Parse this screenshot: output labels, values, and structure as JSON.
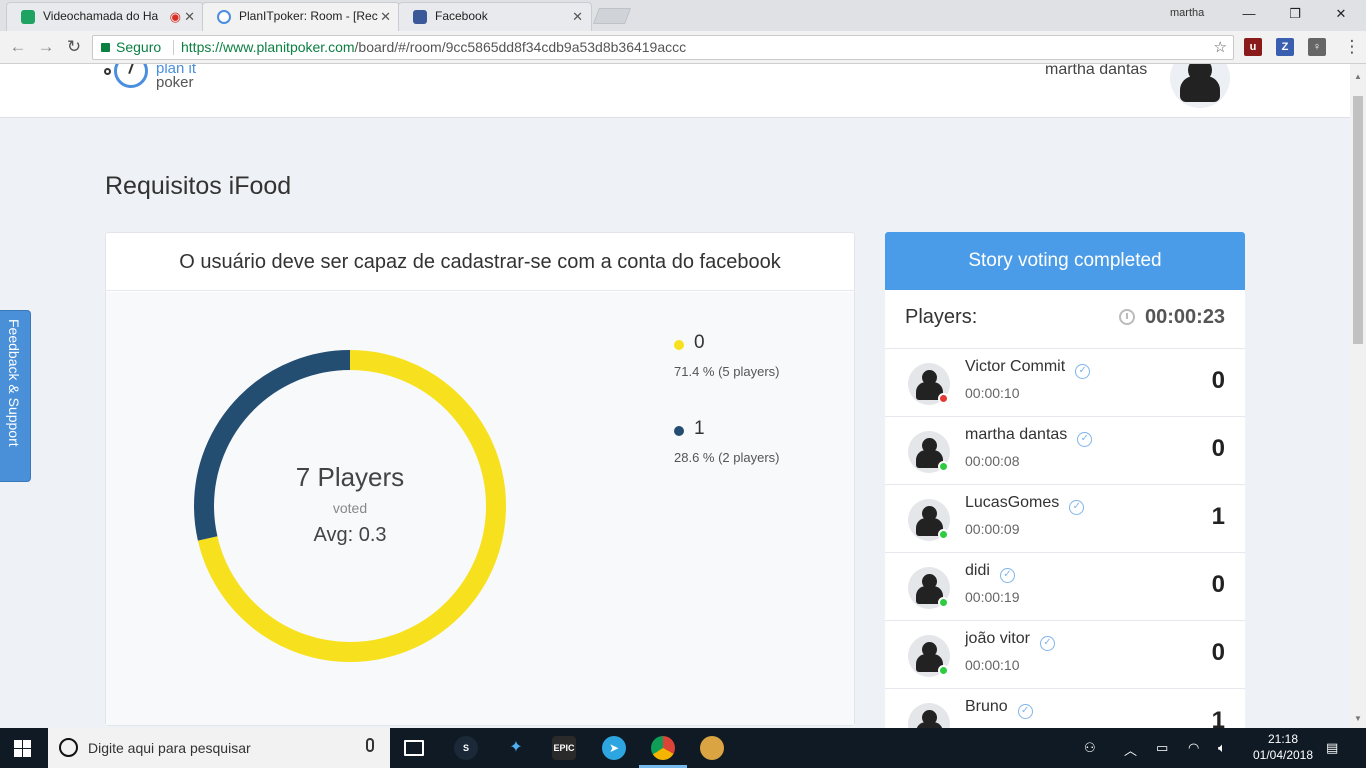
{
  "browser": {
    "tabs": [
      {
        "title": "Videochamada do Ha",
        "icon_color": "#1ea362"
      },
      {
        "title": "PlanITpoker: Room - [Rec",
        "icon_color": "#4a8fdf"
      },
      {
        "title": "Facebook",
        "icon_color": "#3b5998"
      }
    ],
    "profile_name": "martha",
    "secure_label": "Seguro",
    "url_host": "https://www.planitpoker.com",
    "url_path": "/board/#/room/9cc5865dd8f34cdb9a53d8b36419accc"
  },
  "header": {
    "brand_top": "plan it",
    "brand_bottom": "poker",
    "username": "martha dantas"
  },
  "room": {
    "title": "Requisitos iFood"
  },
  "story": {
    "title": "O usuário deve ser capaz de cadastrar-se com a conta do facebook",
    "center_players": "7 Players",
    "center_voted": "voted",
    "center_avg": "Avg: 0.3"
  },
  "chart_data": {
    "type": "pie",
    "donut": true,
    "categories": [
      "0",
      "1"
    ],
    "values": [
      71.4,
      28.6
    ],
    "players": [
      5,
      2
    ],
    "colors": [
      "#f7e11e",
      "#234d71"
    ],
    "legend": [
      {
        "label": "0",
        "detail": "71.4 % (5 players)",
        "color": "#f7e11e"
      },
      {
        "label": "1",
        "detail": "28.6 % (2 players)",
        "color": "#234d71"
      }
    ]
  },
  "sidebar": {
    "status": "Story voting completed",
    "players_label": "Players:",
    "timer": "00:00:23",
    "players": [
      {
        "name": "Victor Commit",
        "time": "00:00:10",
        "vote": "0",
        "presence": "#e53935"
      },
      {
        "name": "martha dantas",
        "time": "00:00:08",
        "vote": "0",
        "presence": "#2ecc40"
      },
      {
        "name": "LucasGomes",
        "time": "00:00:09",
        "vote": "1",
        "presence": "#2ecc40"
      },
      {
        "name": "didi",
        "time": "00:00:19",
        "vote": "0",
        "presence": "#2ecc40"
      },
      {
        "name": "joão vitor",
        "time": "00:00:10",
        "vote": "0",
        "presence": "#2ecc40"
      },
      {
        "name": "Bruno",
        "time": "",
        "vote": "1",
        "presence": "#2ecc40"
      }
    ]
  },
  "feedback_label": "Feedback & Support",
  "taskbar": {
    "search_placeholder": "Digite aqui para pesquisar",
    "time": "21:18",
    "date": "01/04/2018",
    "epic_label": "EPIC"
  }
}
